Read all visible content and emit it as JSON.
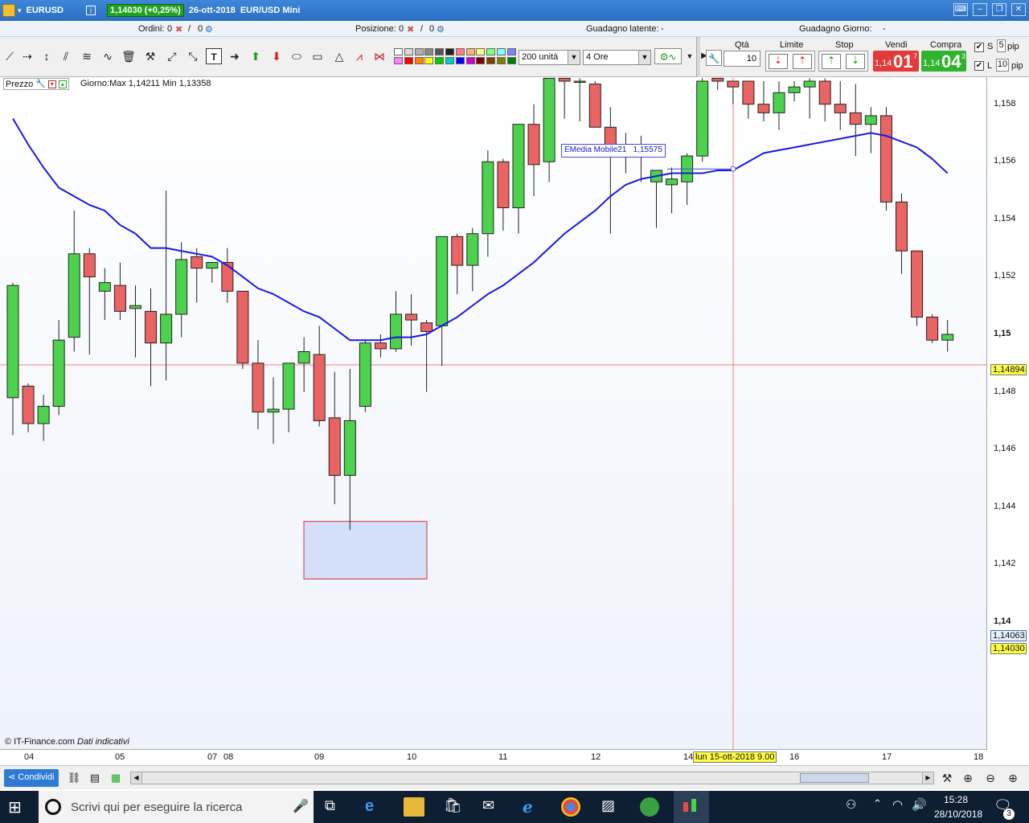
{
  "titlebar": {
    "symbol": "EURUSD",
    "change": "1,14030 (+0,25%)",
    "date": "26-ott-2018",
    "instrument": "EUR/USD Mini"
  },
  "infobar": {
    "orders_label": "Ordini:",
    "orders_value": "0",
    "orders_count": "0",
    "position_label": "Posizione:",
    "position_value": "0",
    "position_count": "0",
    "latent_label": "Guadagno latente:",
    "latent_value": "-",
    "daily_label": "Guadagno Giorno:",
    "daily_value": "-"
  },
  "toolbar": {
    "units_select": "200 unità",
    "timeframe_select": "4 Ore",
    "qty_label": "Qtà",
    "qty_value": "10",
    "limit_label": "Limite",
    "stop_label": "Stop",
    "sell_label": "Vendi",
    "buy_label": "Compra",
    "sell_prefix": "1,14",
    "sell_big": "01",
    "sell_sup": "7",
    "buy_prefix": "1,14",
    "buy_big": "04",
    "buy_sup": "3",
    "s_label": "S",
    "s_value": "5",
    "l_label": "L",
    "l_value": "10",
    "pip_label": "pip",
    "colors": [
      "#ffffff",
      "#d8d8d8",
      "#b0b0b0",
      "#888888",
      "#555555",
      "#222222",
      "#ff8080",
      "#ffb080",
      "#ffff80",
      "#80ff80",
      "#80ffff",
      "#8080ff",
      "#ff80ff",
      "#ff0000",
      "#ff8000",
      "#ffff00",
      "#00cc00",
      "#00cccc",
      "#0000ff",
      "#cc00cc",
      "#800000",
      "#804000",
      "#808000",
      "#008000",
      "#008080",
      "#000080",
      "#800080"
    ]
  },
  "chart": {
    "price_label": "Prezzo",
    "day_info": "Giorno:Max 1,14211 Min 1,13358",
    "ema_label": "EMedia Mobile21",
    "ema_value": "1,15575",
    "copyright": "© IT-Finance.com",
    "disclaimer": "Dati indicativi",
    "crosshair_date": "lun 15-ott-2018 9.00",
    "crosshair_price": "1,14894",
    "tag_ask": "1,14063",
    "tag_bid": "1,14030",
    "colors": {
      "up": "#4cd24c",
      "down": "#ea6464",
      "ema": "#1a1adc",
      "crosshair": "#ef8080"
    }
  },
  "chart_data": {
    "type": "candlestick",
    "y_ticks": [
      "1,158",
      "1,156",
      "1,154",
      "1,152",
      "1,15",
      "1,148",
      "1,146",
      "1,144",
      "1,142",
      "1,14"
    ],
    "x_ticks": [
      "04",
      "05",
      "07",
      "08",
      "09",
      "10",
      "11",
      "12",
      "14",
      "16",
      "17",
      "18"
    ],
    "ylim": [
      1.1388,
      1.1588
    ],
    "candles": [
      {
        "o": 1.1478,
        "h": 1.1518,
        "l": 1.1465,
        "c": 1.1517
      },
      {
        "o": 1.1482,
        "h": 1.1483,
        "l": 1.1466,
        "c": 1.1469
      },
      {
        "o": 1.1469,
        "h": 1.1479,
        "l": 1.1463,
        "c": 1.1475
      },
      {
        "o": 1.1475,
        "h": 1.1505,
        "l": 1.1472,
        "c": 1.1498
      },
      {
        "o": 1.1499,
        "h": 1.1543,
        "l": 1.1494,
        "c": 1.1528
      },
      {
        "o": 1.1528,
        "h": 1.153,
        "l": 1.1493,
        "c": 1.152
      },
      {
        "o": 1.1515,
        "h": 1.1523,
        "l": 1.1505,
        "c": 1.1518
      },
      {
        "o": 1.1517,
        "h": 1.1525,
        "l": 1.1505,
        "c": 1.1508
      },
      {
        "o": 1.1509,
        "h": 1.1517,
        "l": 1.1492,
        "c": 1.151
      },
      {
        "o": 1.1508,
        "h": 1.1516,
        "l": 1.1482,
        "c": 1.1497
      },
      {
        "o": 1.1497,
        "h": 1.155,
        "l": 1.1484,
        "c": 1.1507
      },
      {
        "o": 1.1507,
        "h": 1.1532,
        "l": 1.1499,
        "c": 1.1526
      },
      {
        "o": 1.1527,
        "h": 1.153,
        "l": 1.1511,
        "c": 1.1523
      },
      {
        "o": 1.1523,
        "h": 1.1525,
        "l": 1.1518,
        "c": 1.1525
      },
      {
        "o": 1.1525,
        "h": 1.153,
        "l": 1.1511,
        "c": 1.1515
      },
      {
        "o": 1.1515,
        "h": 1.1507,
        "l": 1.1488,
        "c": 1.149
      },
      {
        "o": 1.149,
        "h": 1.1498,
        "l": 1.1467,
        "c": 1.1473
      },
      {
        "o": 1.1473,
        "h": 1.1485,
        "l": 1.1462,
        "c": 1.1474
      },
      {
        "o": 1.1474,
        "h": 1.149,
        "l": 1.1466,
        "c": 1.149
      },
      {
        "o": 1.149,
        "h": 1.1499,
        "l": 1.148,
        "c": 1.1494
      },
      {
        "o": 1.1493,
        "h": 1.1503,
        "l": 1.1468,
        "c": 1.147
      },
      {
        "o": 1.1471,
        "h": 1.1487,
        "l": 1.1441,
        "c": 1.1451
      },
      {
        "o": 1.1451,
        "h": 1.1488,
        "l": 1.1432,
        "c": 1.147
      },
      {
        "o": 1.1475,
        "h": 1.1498,
        "l": 1.1473,
        "c": 1.1497
      },
      {
        "o": 1.1497,
        "h": 1.15,
        "l": 1.1492,
        "c": 1.1495
      },
      {
        "o": 1.1495,
        "h": 1.1515,
        "l": 1.1494,
        "c": 1.1507
      },
      {
        "o": 1.1507,
        "h": 1.1514,
        "l": 1.1496,
        "c": 1.1505
      },
      {
        "o": 1.1504,
        "h": 1.1505,
        "l": 1.148,
        "c": 1.1501
      },
      {
        "o": 1.1503,
        "h": 1.1534,
        "l": 1.1489,
        "c": 1.1534
      },
      {
        "o": 1.1534,
        "h": 1.1535,
        "l": 1.1514,
        "c": 1.1524
      },
      {
        "o": 1.1524,
        "h": 1.1537,
        "l": 1.1515,
        "c": 1.1535
      },
      {
        "o": 1.1535,
        "h": 1.1564,
        "l": 1.1527,
        "c": 1.156
      },
      {
        "o": 1.156,
        "h": 1.1561,
        "l": 1.1536,
        "c": 1.1544
      },
      {
        "o": 1.1544,
        "h": 1.1573,
        "l": 1.1535,
        "c": 1.1573
      },
      {
        "o": 1.1573,
        "h": 1.158,
        "l": 1.1548,
        "c": 1.1559
      },
      {
        "o": 1.156,
        "h": 1.1589,
        "l": 1.1553,
        "c": 1.1589
      },
      {
        "o": 1.1589,
        "h": 1.1589,
        "l": 1.1575,
        "c": 1.1588
      },
      {
        "o": 1.1588,
        "h": 1.1589,
        "l": 1.1574,
        "c": 1.1588
      },
      {
        "o": 1.1587,
        "h": 1.1588,
        "l": 1.1575,
        "c": 1.1572
      },
      {
        "o": 1.1572,
        "h": 1.1579,
        "l": 1.1535,
        "c": 1.1563
      },
      {
        "o": 1.1563,
        "h": 1.157,
        "l": 1.1556,
        "c": 1.1565
      },
      {
        "o": 1.1566,
        "h": 1.1569,
        "l": 1.1553,
        "c": 1.1562
      },
      {
        "o": 1.1553,
        "h": 1.1556,
        "l": 1.1537,
        "c": 1.1557
      },
      {
        "o": 1.1552,
        "h": 1.1558,
        "l": 1.1542,
        "c": 1.1554
      },
      {
        "o": 1.1553,
        "h": 1.1563,
        "l": 1.1545,
        "c": 1.1562
      },
      {
        "o": 1.1562,
        "h": 1.1589,
        "l": 1.156,
        "c": 1.1588
      },
      {
        "o": 1.1589,
        "h": 1.1589,
        "l": 1.1585,
        "c": 1.1588
      },
      {
        "o": 1.1588,
        "h": 1.1588,
        "l": 1.158,
        "c": 1.1586
      },
      {
        "o": 1.1588,
        "h": 1.1588,
        "l": 1.1575,
        "c": 1.158
      },
      {
        "o": 1.158,
        "h": 1.1588,
        "l": 1.1574,
        "c": 1.1577
      },
      {
        "o": 1.1577,
        "h": 1.1588,
        "l": 1.1571,
        "c": 1.1584
      },
      {
        "o": 1.1584,
        "h": 1.1588,
        "l": 1.1581,
        "c": 1.1586
      },
      {
        "o": 1.1586,
        "h": 1.1589,
        "l": 1.1575,
        "c": 1.1588
      },
      {
        "o": 1.1588,
        "h": 1.1589,
        "l": 1.1574,
        "c": 1.158
      },
      {
        "o": 1.158,
        "h": 1.1588,
        "l": 1.1571,
        "c": 1.1577
      },
      {
        "o": 1.1577,
        "h": 1.1587,
        "l": 1.1562,
        "c": 1.1573
      },
      {
        "o": 1.1573,
        "h": 1.1579,
        "l": 1.1563,
        "c": 1.1576
      },
      {
        "o": 1.1576,
        "h": 1.1579,
        "l": 1.1543,
        "c": 1.1546
      },
      {
        "o": 1.1546,
        "h": 1.1549,
        "l": 1.1521,
        "c": 1.1529
      },
      {
        "o": 1.1529,
        "h": 1.1529,
        "l": 1.1503,
        "c": 1.1506
      },
      {
        "o": 1.1506,
        "h": 1.1507,
        "l": 1.1497,
        "c": 1.1498
      },
      {
        "o": 1.1498,
        "h": 1.1505,
        "l": 1.1494,
        "c": 1.15
      }
    ],
    "ema": [
      1.1575,
      1.1566,
      1.1558,
      1.1551,
      1.1548,
      1.1545,
      1.1543,
      1.1538,
      1.1535,
      1.153,
      1.153,
      1.1529,
      1.1528,
      1.1527,
      1.1524,
      1.152,
      1.1516,
      1.1514,
      1.1511,
      1.1508,
      1.1506,
      1.1502,
      1.1498,
      1.1498,
      1.1498,
      1.1499,
      1.1499,
      1.15,
      1.1503,
      1.1506,
      1.151,
      1.1514,
      1.1517,
      1.1521,
      1.1525,
      1.153,
      1.1535,
      1.1539,
      1.1543,
      1.1548,
      1.1552,
      1.1554,
      1.1555,
      1.1556,
      1.1556,
      1.1556,
      1.1557,
      1.1557,
      1.156,
      1.1563,
      1.1564,
      1.1565,
      1.1566,
      1.1567,
      1.1568,
      1.1569,
      1.157,
      1.1569,
      1.1567,
      1.1565,
      1.1561,
      1.1556
    ],
    "highlight_box": {
      "y_top": 1.1435,
      "y_bottom": 1.1415
    }
  },
  "bottombar": {
    "share_label": "Condividi"
  },
  "taskbar": {
    "search_placeholder": "Scrivi qui per eseguire la ricerca",
    "time": "15:28",
    "date": "28/10/2018",
    "notif_count": "3"
  }
}
